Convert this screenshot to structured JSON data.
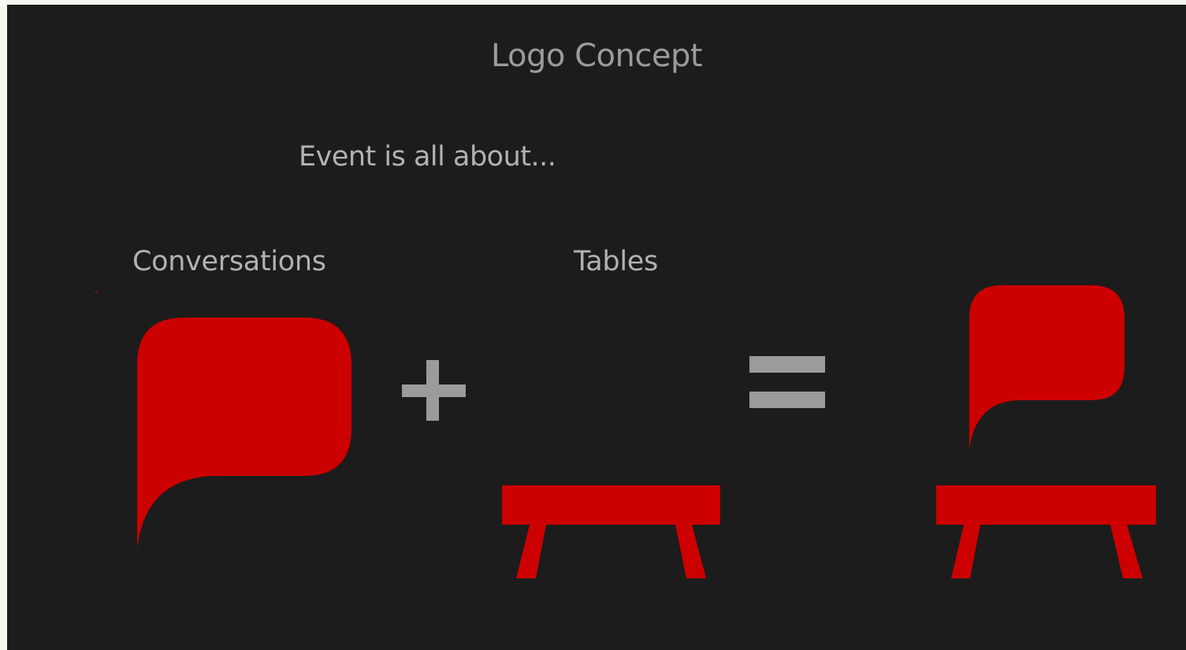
{
  "slide": {
    "title": "Logo Concept",
    "subtitle": "Event is all about...",
    "left_label": "Conversations",
    "right_label": "Tables"
  },
  "icons": {
    "first": "speech-bubble-icon",
    "operator_plus": "plus-icon",
    "second": "table-icon",
    "operator_equals": "equals-icon",
    "result": "speech-bubble-on-table-logo-icon"
  },
  "colors": {
    "background": "#1c1c1c",
    "brand_red": "#cc0000",
    "text_gray": "#b2b2b2",
    "operator_gray": "#9b9b9b",
    "page_margin": "#f7f6f0"
  }
}
